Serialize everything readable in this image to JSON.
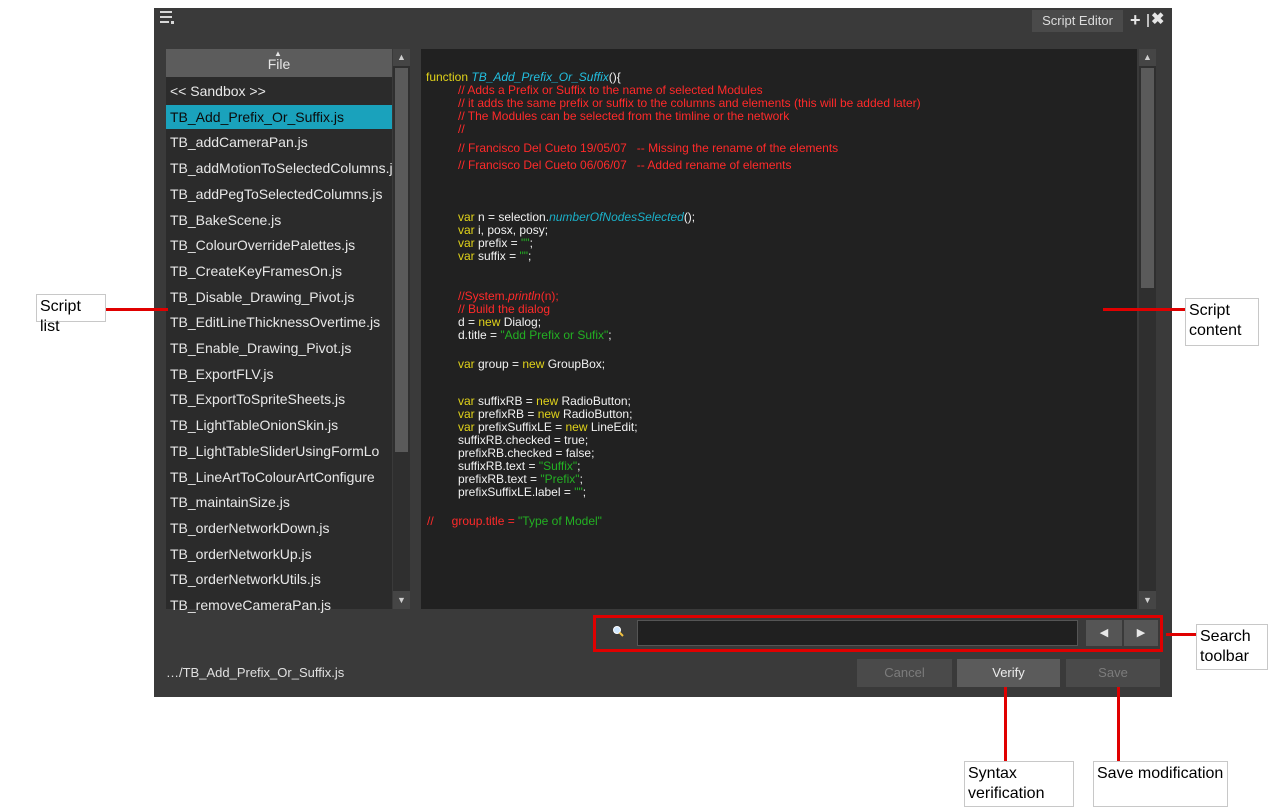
{
  "window": {
    "tab_label": "Script Editor",
    "plus_glyph": "+",
    "close_glyph": "✖"
  },
  "script_list": {
    "header": "File",
    "items": [
      "<< Sandbox >>",
      "TB_Add_Prefix_Or_Suffix.js",
      "TB_addCameraPan.js",
      "TB_addMotionToSelectedColumns.js",
      "TB_addPegToSelectedColumns.js",
      "TB_BakeScene.js",
      "TB_ColourOverridePalettes.js",
      "TB_CreateKeyFramesOn.js",
      "TB_Disable_Drawing_Pivot.js",
      "TB_EditLineThicknessOvertime.js",
      "TB_Enable_Drawing_Pivot.js",
      "TB_ExportFLV.js",
      "TB_ExportToSpriteSheets.js",
      "TB_LightTableOnionSkin.js",
      "TB_LightTableSliderUsingFormLo",
      "TB_LineArtToColourArtConfigure",
      "TB_maintainSize.js",
      "TB_orderNetworkDown.js",
      "TB_orderNetworkUp.js",
      "TB_orderNetworkUtils.js",
      "TB_removeCameraPan.js"
    ],
    "selected_index": 1
  },
  "code": {
    "l1_kw": "function ",
    "l1_fn": "TB_Add_Prefix_Or_Suffix",
    "l1_end": "(){",
    "c1": "// Adds a Prefix or Suffix to the name of selected Modules",
    "c2": "// it adds the same prefix or suffix to the columns and elements (this will be added later)",
    "c3": "// The Modules can be selected from the timline or the network",
    "c4": "//",
    "c5": "// Francisco Del Cueto 19/05/07   -- Missing the rename of the elements",
    "c6": "// Francisco Del Cueto 06/06/07   -- Added rename of elements",
    "v1_kw": "var",
    "v1_a": " n = selection.",
    "v1_m": "numberOfNodesSelected",
    "v1_b": "();",
    "v2_kw": "var",
    "v2_a": " i, posx, posy;",
    "v3_kw": "var",
    "v3_a": " prefix = ",
    "v3_s": "\"\"",
    "v3_b": ";",
    "v4_kw": "var",
    "v4_a": " suffix = ",
    "v4_s": "\"\"",
    "v4_b": ";",
    "p1_c": "//System.",
    "p1_m": "println",
    "p1_b": "(n);",
    "p2_c": "// Build the dialog",
    "d1_a": "d = ",
    "d1_kw": "new",
    "d1_b": " Dialog;",
    "d2_a": "d.title = ",
    "d2_s": "\"Add Prefix or Sufix\"",
    "d2_b": ";",
    "g_kw": "var",
    "g_a": " group = ",
    "g_new": "new",
    "g_b": " GroupBox;",
    "r1_kw": "var",
    "r1_a": " suffixRB = ",
    "r1_new": "new",
    "r1_b": " RadioButton;",
    "r2_kw": "var",
    "r2_a": " prefixRB = ",
    "r2_new": "new",
    "r2_b": " RadioButton;",
    "r3_kw": "var",
    "r3_a": " prefixSuffixLE = ",
    "r3_new": "new",
    "r3_b": " LineEdit;",
    "s1": "suffixRB.checked = true;",
    "s2": "prefixRB.checked = false;",
    "s3_a": "suffixRB.text = ",
    "s3_s": "\"Suffix\"",
    "s3_b": ";",
    "s4_a": "prefixRB.text = ",
    "s4_s": "\"Prefix\"",
    "s4_b": ";",
    "s5_a": "prefixSuffixLE.label = ",
    "s5_s": "\"\"",
    "s5_b": ";",
    "gt_c": "//",
    "gt_c2": "group.title = ",
    "gt_s": "\"Type of Model\""
  },
  "search": {
    "value": "",
    "prev_glyph": "◀",
    "next_glyph": "▶"
  },
  "footer": {
    "path": "…/TB_Add_Prefix_Or_Suffix.js",
    "cancel": "Cancel",
    "verify": "Verify",
    "save": "Save"
  },
  "callouts": {
    "script_list": "Script list",
    "script_content": "Script content",
    "search_toolbar": "Search toolbar",
    "syntax_verification": "Syntax verification",
    "save_modification": "Save modification"
  },
  "colors": {
    "selection": "#1aa2bc",
    "callout_line": "#e00000",
    "keyword": "#e0d21a",
    "comment": "#ff2a2a",
    "string": "#23b023"
  }
}
